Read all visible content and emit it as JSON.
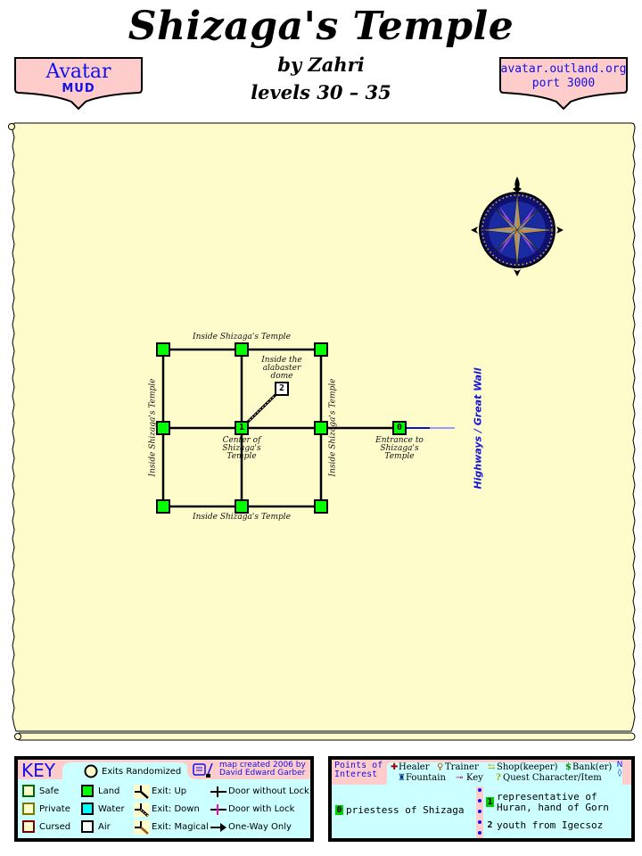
{
  "header": {
    "title": "Shizaga's Temple",
    "author": "by Zahri",
    "levels": "levels 30 – 35"
  },
  "badges": {
    "left": {
      "line1": "Avatar",
      "line2": "MUD"
    },
    "right": {
      "line1": "avatar.outland.org",
      "line2": "port 3000"
    }
  },
  "colors": {
    "parchment": "#fffccc",
    "room_land": "#00ff00",
    "zone_link": "#1515dd",
    "badge_fill": "#ffcccc",
    "panel_fill": "#ccffff",
    "panel_header": "#ffcccc"
  },
  "map": {
    "compass": "compass-rose-icon",
    "labels": {
      "top": "Inside Shizaga's Temple",
      "bottom": "Inside Shizaga's Temple",
      "left": "Inside Shizaga's Temple",
      "right": "Inside Shizaga's Temple",
      "dome": [
        "Inside the",
        "alabaster",
        "dome"
      ],
      "center": [
        "Center of",
        "Shizaga's",
        "Temple"
      ],
      "entrance": [
        "Entrance to",
        "Shizaga's",
        "Temple"
      ],
      "zone_link": "Highways / Great Wall"
    },
    "rooms": [
      {
        "id": "nw",
        "label": ""
      },
      {
        "id": "n",
        "label": ""
      },
      {
        "id": "ne",
        "label": ""
      },
      {
        "id": "w",
        "label": ""
      },
      {
        "id": "center",
        "label": "1"
      },
      {
        "id": "e",
        "label": ""
      },
      {
        "id": "sw",
        "label": ""
      },
      {
        "id": "s",
        "label": ""
      },
      {
        "id": "se",
        "label": ""
      },
      {
        "id": "entrance",
        "label": "0"
      },
      {
        "id": "dome",
        "label": "2"
      }
    ]
  },
  "key": {
    "title": "KEY",
    "exits_randomized": "Exits Randomized",
    "credit": [
      "map created 2006 by",
      "David Edward Garber"
    ],
    "room_types": [
      "Safe",
      "Private",
      "Cursed"
    ],
    "terrain": [
      "Land",
      "Water",
      "Air"
    ],
    "exits": [
      "Exit: Up",
      "Exit: Down",
      "Exit: Magical"
    ],
    "doors": [
      "Door without Lock",
      "Door with Lock",
      "One-Way Only"
    ]
  },
  "poi": {
    "title": [
      "Points of",
      "Interest"
    ],
    "legend": {
      "healer": "Healer",
      "trainer": "Trainer",
      "shop": "Shop(keeper)",
      "bank": "Bank(er)",
      "fountain": "Fountain",
      "key": "Key",
      "quest": "Quest Character/Item"
    },
    "entries": [
      {
        "num": "0",
        "text": "priestess of Shizaga"
      },
      {
        "num": "1",
        "text": [
          "representative of",
          "Huran, hand of Gorn"
        ]
      },
      {
        "num": "2",
        "text": "youth from Igecsoz"
      }
    ]
  }
}
